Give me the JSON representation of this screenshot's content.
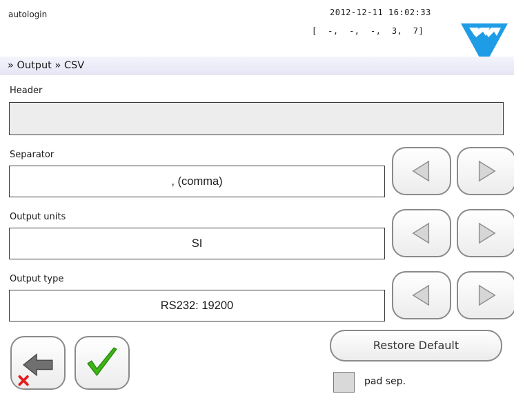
{
  "status": {
    "user": "autologin",
    "datetime": "2012-12-11 16:02:33",
    "counters": "[  -,  -,  -,  3,  7]"
  },
  "breadcrumb": "» Output » CSV",
  "header": {
    "label": "Header",
    "value": ""
  },
  "separator": {
    "label": "Separator",
    "value": ", (comma)"
  },
  "output_units": {
    "label": "Output units",
    "value": "SI"
  },
  "output_type": {
    "label": "Output type",
    "value": "RS232: 19200"
  },
  "restore_label": "Restore Default",
  "pad_sep": {
    "label": "pad sep.",
    "checked": false
  },
  "colors": {
    "logo_blue": "#1f9ce6",
    "check_green": "#3cb515",
    "cancel_red": "#e21b1b",
    "breadcrumb_bg": "#e6e6f6"
  },
  "icons": {
    "logo": "triangle-logo-icon",
    "prev": "left-arrow-icon",
    "next": "right-arrow-icon",
    "back": "back-cancel-icon",
    "ok": "check-icon"
  }
}
